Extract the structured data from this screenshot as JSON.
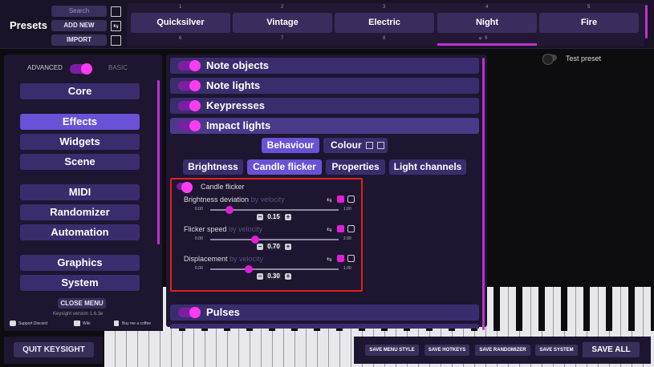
{
  "header": {
    "title": "Presets",
    "search_placeholder": "Search",
    "add_new_label": "ADD NEW",
    "import_label": "IMPORT",
    "presets": [
      {
        "num": "1",
        "name": "Quicksilver"
      },
      {
        "num": "2",
        "name": "Vintage"
      },
      {
        "num": "3",
        "name": "Electric"
      },
      {
        "num": "4",
        "name": "Night"
      },
      {
        "num": "5",
        "name": "Fire"
      }
    ],
    "row2_nums": [
      "6",
      "7",
      "8",
      "9"
    ],
    "star_label": "9"
  },
  "mode": {
    "advanced": "ADVANCED",
    "basic": "BASIC"
  },
  "nav": {
    "core": "Core",
    "effects": "Effects",
    "widgets": "Widgets",
    "scene": "Scene",
    "midi": "MIDI",
    "randomizer": "Randomizer",
    "automation": "Automation",
    "graphics": "Graphics",
    "system": "System"
  },
  "sidebar_footer": {
    "close_menu": "CLOSE MENU",
    "version": "Keysight version 1.6.3e",
    "discord": "Support Discord",
    "wiki": "Wiki",
    "coffee": "Buy me a coffee"
  },
  "sections": {
    "note_objects": "Note objects",
    "note_lights": "Note lights",
    "keypresses": "Keypresses",
    "impact_lights": "Impact lights",
    "pulses": "Pulses"
  },
  "subtabs": {
    "behaviour": "Behaviour",
    "colour": "Colour"
  },
  "tabs": {
    "brightness": "Brightness",
    "candle_flicker": "Candle flicker",
    "properties": "Properties",
    "light_channels": "Light channels"
  },
  "candle": {
    "toggle_label": "Candle flicker",
    "sliders": [
      {
        "label": "Brightness deviation",
        "suffix": "by velocity",
        "min": "0.00",
        "max": "1.00",
        "value": "0.15"
      },
      {
        "label": "Flicker speed",
        "suffix": "by velocity",
        "min": "0.00",
        "max": "2.00",
        "value": "0.70"
      },
      {
        "label": "Displacement",
        "suffix": "by velocity",
        "min": "0.00",
        "max": "1.00",
        "value": "0.30"
      }
    ]
  },
  "test_preset": "Test preset",
  "bottom": {
    "quit": "QUIT KEYSIGHT",
    "save_menu_style": "SAVE MENU STYLE",
    "save_hotkeys": "SAVE HOTKEYS",
    "save_randomizer": "SAVE RANDOMIZER",
    "save_system": "SAVE SYSTEM",
    "save_all": "SAVE ALL"
  },
  "colors": {
    "accent": "#ff3cf0",
    "panel": "#1e1530",
    "button": "#3a2d6e",
    "active": "#6a52d6",
    "highlight": "#e02020"
  }
}
